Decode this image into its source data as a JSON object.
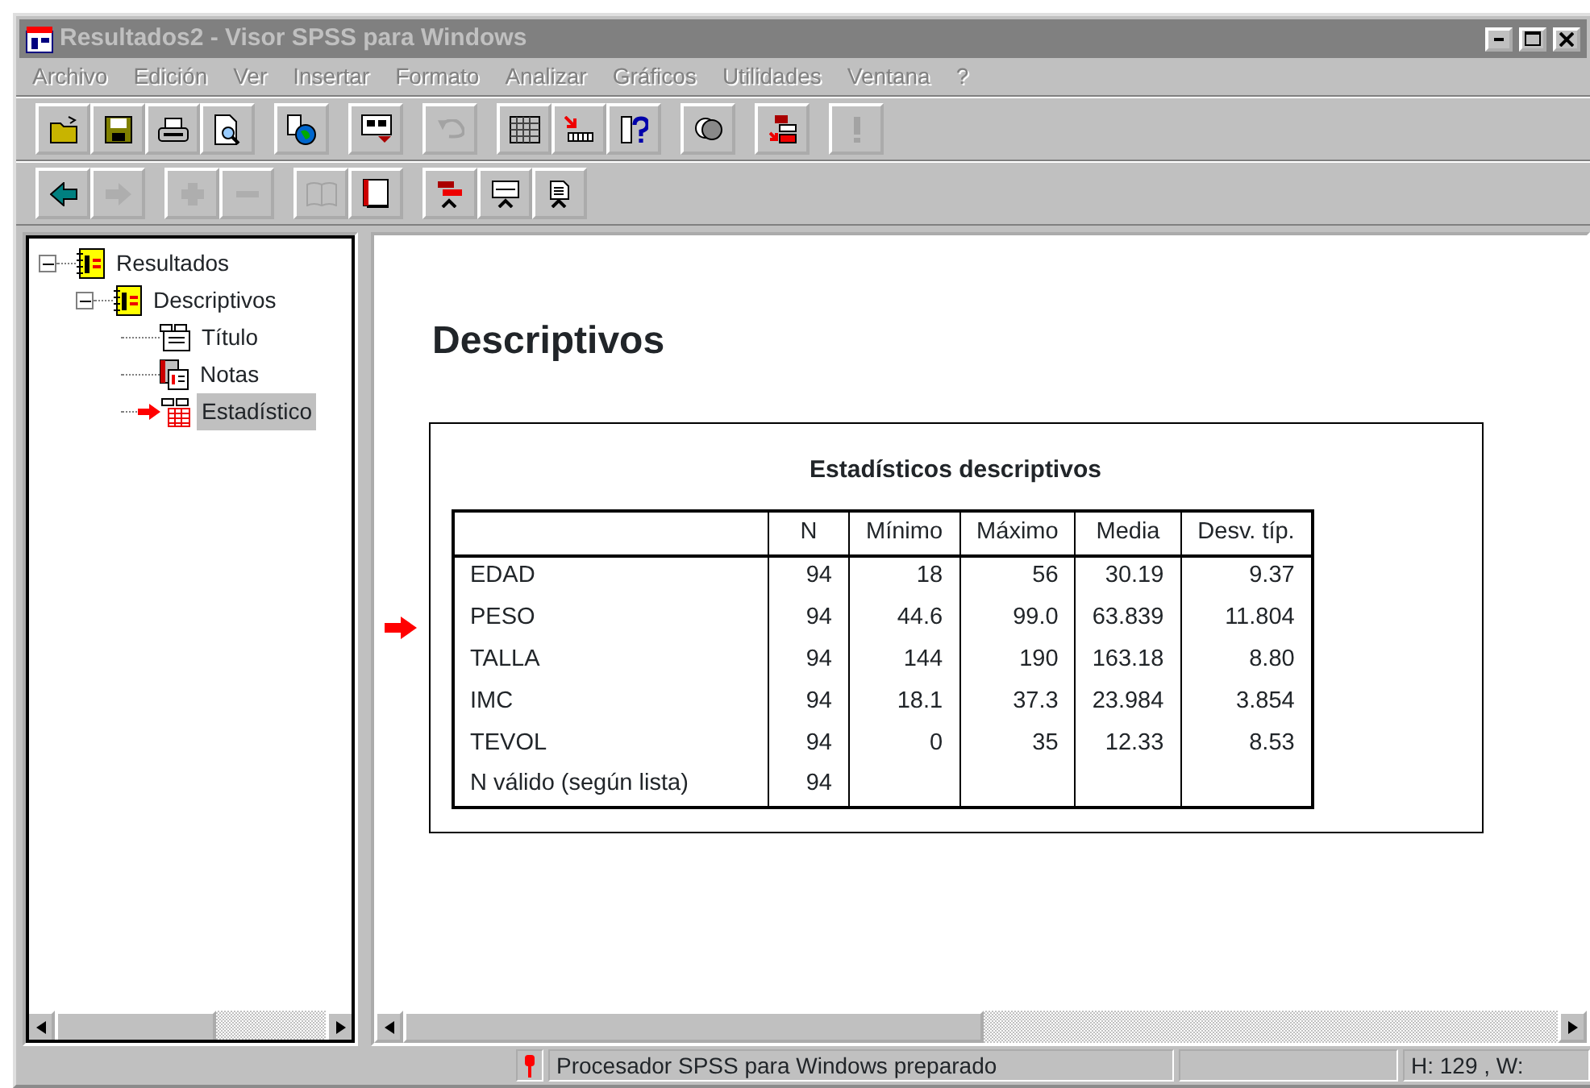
{
  "window": {
    "title": "Resultados2 - Visor SPSS para Windows",
    "active": false
  },
  "menu": [
    {
      "label": "Archivo",
      "disabled": true
    },
    {
      "label": "Edición",
      "disabled": true
    },
    {
      "label": "Ver",
      "disabled": true
    },
    {
      "label": "Insertar",
      "disabled": true
    },
    {
      "label": "Formato",
      "disabled": true
    },
    {
      "label": "Analizar",
      "disabled": true
    },
    {
      "label": "Gráficos",
      "disabled": true
    },
    {
      "label": "Utilidades",
      "disabled": true
    },
    {
      "label": "Ventana",
      "disabled": true
    },
    {
      "label": "?",
      "disabled": true
    }
  ],
  "toolbars": [
    [
      [
        {
          "disabled": false
        },
        {
          "disabled": false
        },
        {
          "disabled": false
        },
        {
          "disabled": false
        }
      ],
      [
        {
          "disabled": false
        }
      ],
      [
        {
          "disabled": false
        }
      ],
      [
        {
          "disabled": true
        }
      ],
      [
        {
          "disabled": false
        },
        {
          "disabled": false
        },
        {
          "disabled": false
        }
      ],
      [
        {
          "disabled": false
        }
      ],
      [
        {
          "disabled": false
        }
      ],
      [
        {
          "disabled": true
        }
      ]
    ],
    [
      [
        {
          "disabled": false
        },
        {
          "disabled": true
        }
      ],
      [
        {
          "disabled": true
        },
        {
          "disabled": true
        }
      ],
      [
        {
          "disabled": true
        },
        {
          "disabled": false
        }
      ],
      [
        {
          "disabled": false
        },
        {
          "disabled": false
        },
        {
          "disabled": false
        }
      ]
    ]
  ],
  "outline": [
    {
      "label": "Resultados",
      "kind": "book",
      "expanded": true,
      "selected": false,
      "current": false,
      "children": [
        {
          "label": "Descriptivos",
          "kind": "book",
          "expanded": true,
          "selected": false,
          "current": false,
          "children": [
            {
              "label": "Título",
              "kind": "title",
              "selected": false,
              "current": false
            },
            {
              "label": "Notas",
              "kind": "notes",
              "selected": false,
              "current": false
            },
            {
              "label": "Estadístico",
              "kind": "table",
              "selected": true,
              "current": true
            }
          ]
        }
      ]
    }
  ],
  "output": {
    "heading": "Descriptivos",
    "current": true,
    "table": {
      "title": "Estadísticos descriptivos",
      "columns": [
        "N",
        "Mínimo",
        "Máximo",
        "Media",
        "Desv. típ."
      ],
      "rows": [
        {
          "label": "EDAD",
          "cells": [
            "94",
            "18",
            "56",
            "30.19",
            "9.37"
          ]
        },
        {
          "label": "PESO",
          "cells": [
            "94",
            "44.6",
            "99.0",
            "63.839",
            "11.804"
          ]
        },
        {
          "label": "TALLA",
          "cells": [
            "94",
            "144",
            "190",
            "163.18",
            "8.80"
          ]
        },
        {
          "label": "IMC",
          "cells": [
            "94",
            "18.1",
            "37.3",
            "23.984",
            "3.854"
          ]
        },
        {
          "label": "TEVOL",
          "cells": [
            "94",
            "0",
            "35",
            "12.33",
            "8.53"
          ]
        },
        {
          "label": "N válido (según lista)",
          "cells": [
            "94"
          ]
        }
      ]
    }
  },
  "status_bar": {
    "message": "Procesador SPSS para Windows preparado",
    "position": "H: 129 , W:"
  }
}
